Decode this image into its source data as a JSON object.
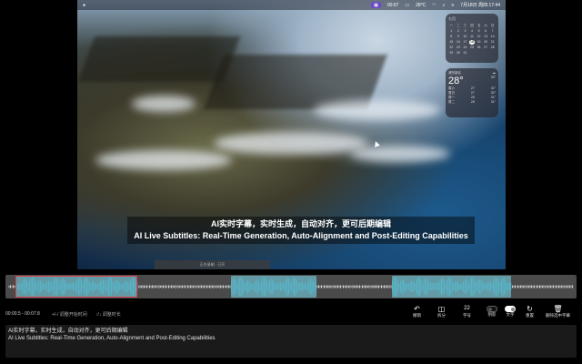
{
  "menubar": {
    "apple": "",
    "rec_label": "",
    "timer": "00:07",
    "temperature": "28°C",
    "datetime": "7月18日 周四 17:44"
  },
  "calendar": {
    "month": "七月",
    "days_header": [
      "一",
      "二",
      "三",
      "四",
      "五",
      "六",
      "日"
    ],
    "days": [
      "1",
      "2",
      "3",
      "4",
      "5",
      "6",
      "7",
      "8",
      "9",
      "10",
      "11",
      "12",
      "13",
      "14",
      "15",
      "16",
      "17",
      "18",
      "19",
      "20",
      "21",
      "22",
      "23",
      "24",
      "25",
      "26",
      "27",
      "28",
      "29",
      "30",
      "31"
    ],
    "today": "18"
  },
  "weather": {
    "city": "浦东新区",
    "temp": "28°",
    "hi_lo": "33°",
    "forecast": [
      {
        "day": "周六",
        "hi": "27",
        "lo": "31°"
      },
      {
        "day": "周日",
        "hi": "27",
        "lo": "30°"
      },
      {
        "day": "周一",
        "hi": "26",
        "lo": "31°"
      },
      {
        "day": "周二",
        "hi": "26",
        "lo": "31°"
      }
    ]
  },
  "overlay": {
    "line1": "AI实时字幕，实时生成，自动对齐，更可后期编辑",
    "line2": "AI Live Subtitles: Real-Time Generation, Auto-Alignment and Post-Editing Capabilities",
    "small_bar": "正在录制 · 已开"
  },
  "controls": {
    "time_range": "00:00.5 - 00:07.8",
    "hint1": "+/-/ 调整开始时间",
    "hint2": "↑/↓ 调整时长",
    "undo": "撤销",
    "split": "拆分",
    "font_size_value": "22",
    "font_size_label": "字号",
    "shadow_label": "阴影",
    "text_label": "文字",
    "redo": "重置",
    "delete": "删除选中字幕"
  },
  "editor": {
    "line1": "AI实时字幕，实时生成，自动对齐，更可后期编辑",
    "line2": "AI Live Subtitles: Real-Time Generation, Auto-Alignment and Post-Editing Capabilities"
  },
  "colors": {
    "clip": "#6fc4d6",
    "selected_border": "#e0404a",
    "timeline_bg": "#4a4a4a",
    "rec_badge": "#6b4cc4"
  },
  "icons": {
    "undo": "undo-icon",
    "split": "split-icon",
    "redo": "reset-icon",
    "delete": "trash-icon"
  }
}
